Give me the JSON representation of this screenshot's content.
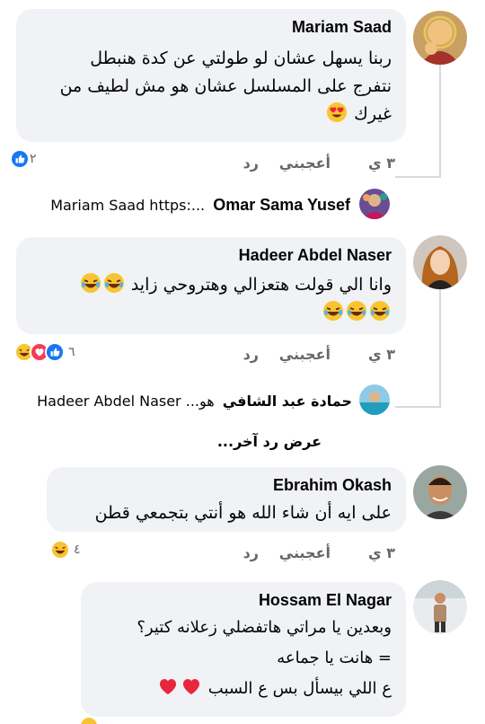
{
  "comments": [
    {
      "author": "Mariam Saad",
      "lines": [
        "ربنا يسهل عشان لو طولتي عن كدة هنبطل",
        "نتفرج على المسلسل عشان هو مش لطيف من",
        "غيرك"
      ],
      "time": "٣ ي",
      "like_label": "أعجبني",
      "reply_label": "رد",
      "reaction_count": "٢",
      "reactions": [
        "like"
      ]
    },
    {
      "author": "Hadeer Abdel Naser",
      "lines": [
        "وانا الي قولت هتعزالي وهتروحي زايد"
      ],
      "time": "٣ ي",
      "like_label": "أعجبني",
      "reply_label": "رد",
      "reaction_count": "٦",
      "reactions": [
        "like",
        "love",
        "haha"
      ]
    },
    {
      "author": "Ebrahim Okash",
      "lines": [
        "على ايه أن شاء الله هو أنتي بتجمعي قطن"
      ],
      "time": "٣ ي",
      "like_label": "أعجبني",
      "reply_label": "رد",
      "reaction_count": "٤",
      "reactions": [
        "haha"
      ]
    },
    {
      "author": "Hossam El Nagar",
      "lines": [
        "وبعدين يا مراتي هاتفضلي زعلانه كتير؟",
        "= هانت يا جماعه",
        "ع اللي بيسأل بس ع السبب"
      ]
    }
  ],
  "replies": [
    {
      "author": "Omar Sama Yusef",
      "preview": "Mariam Saad https:..."
    },
    {
      "author": "حمادة عبد الشافي",
      "preview": "هو... Hadeer Abdel Naser"
    }
  ],
  "more_replies_label": "عرض رد آخر..."
}
